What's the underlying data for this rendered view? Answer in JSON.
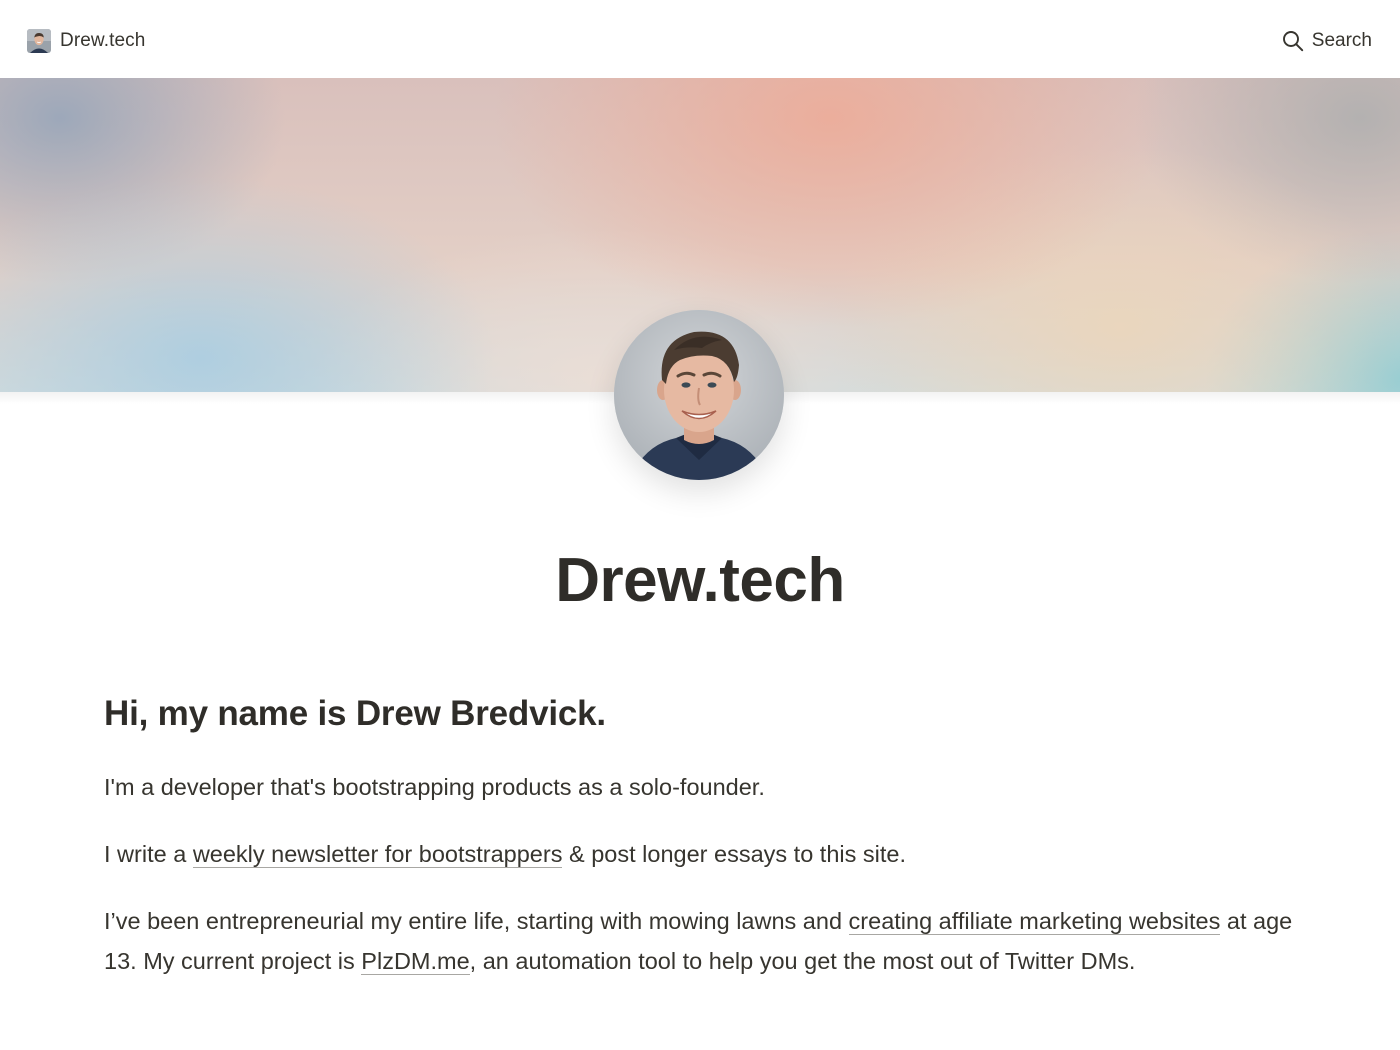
{
  "topbar": {
    "brand_label": "Drew.tech",
    "brand_icon": "avatar-thumbnail",
    "search_label": "Search",
    "search_icon": "search-icon"
  },
  "header": {
    "site_title": "Drew.tech"
  },
  "content": {
    "heading": "Hi, my name is Drew Bredvick.",
    "p1": "I'm a developer that's bootstrapping products as a solo-founder.",
    "p2_before": "I write a ",
    "p2_link": "weekly newsletter for bootstrappers",
    "p2_after": " & post longer essays to this site.",
    "p3_before": "I’ve been entrepreneurial my entire life, starting with mowing lawns and ",
    "p3_link1": "creating affiliate marketing websites",
    "p3_middle": "  at age 13. My current project is ",
    "p3_link2": "PlzDM.me",
    "p3_after": ", an automation tool to help you get the most out of Twitter DMs."
  },
  "colors": {
    "text": "#37352f",
    "title": "#2f2d29",
    "background": "#ffffff",
    "link_underline": "#a8a7a3"
  }
}
